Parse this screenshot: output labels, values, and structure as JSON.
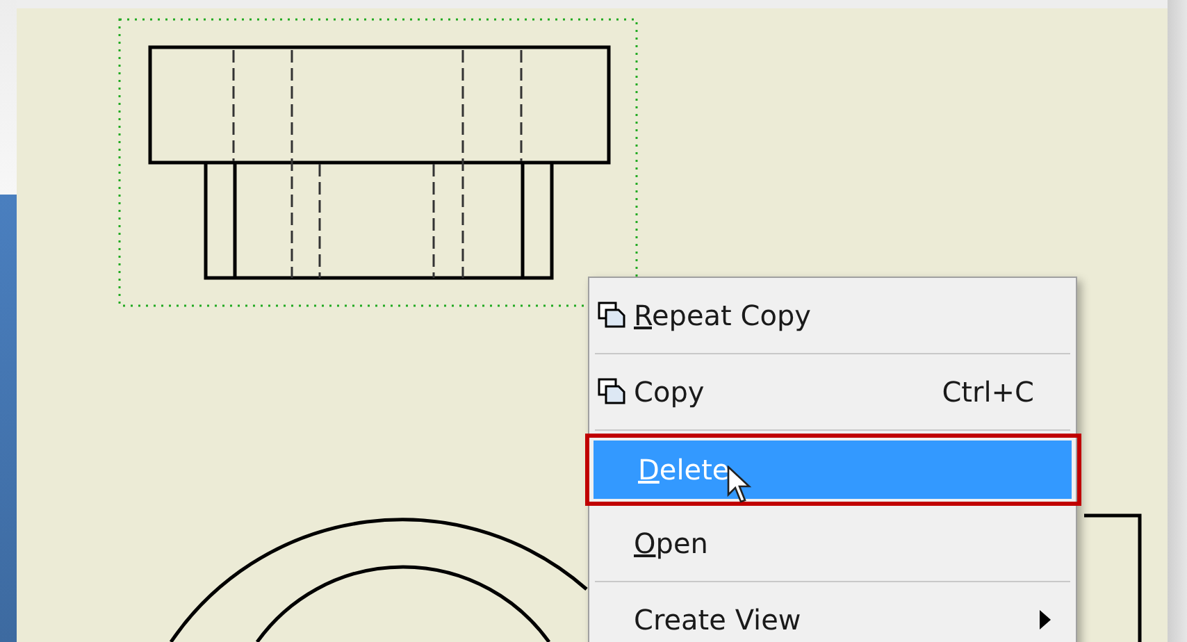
{
  "context_menu": {
    "items": [
      {
        "kind": "command",
        "label": "Repeat Copy",
        "underline_first": true,
        "has_icon": true,
        "selected": false
      },
      {
        "kind": "separator"
      },
      {
        "kind": "command",
        "label": "Copy",
        "underline_first": false,
        "has_icon": true,
        "shortcut": "Ctrl+C",
        "selected": false
      },
      {
        "kind": "separator"
      },
      {
        "kind": "command",
        "label": "Delete",
        "underline_first": true,
        "has_icon": false,
        "selected": true
      },
      {
        "kind": "command",
        "label": "Open",
        "underline_first": true,
        "has_icon": false,
        "selected": false
      },
      {
        "kind": "separator"
      },
      {
        "kind": "command",
        "label": "Create View",
        "underline_first": false,
        "has_icon": false,
        "submenu": true,
        "selected": false
      }
    ]
  }
}
